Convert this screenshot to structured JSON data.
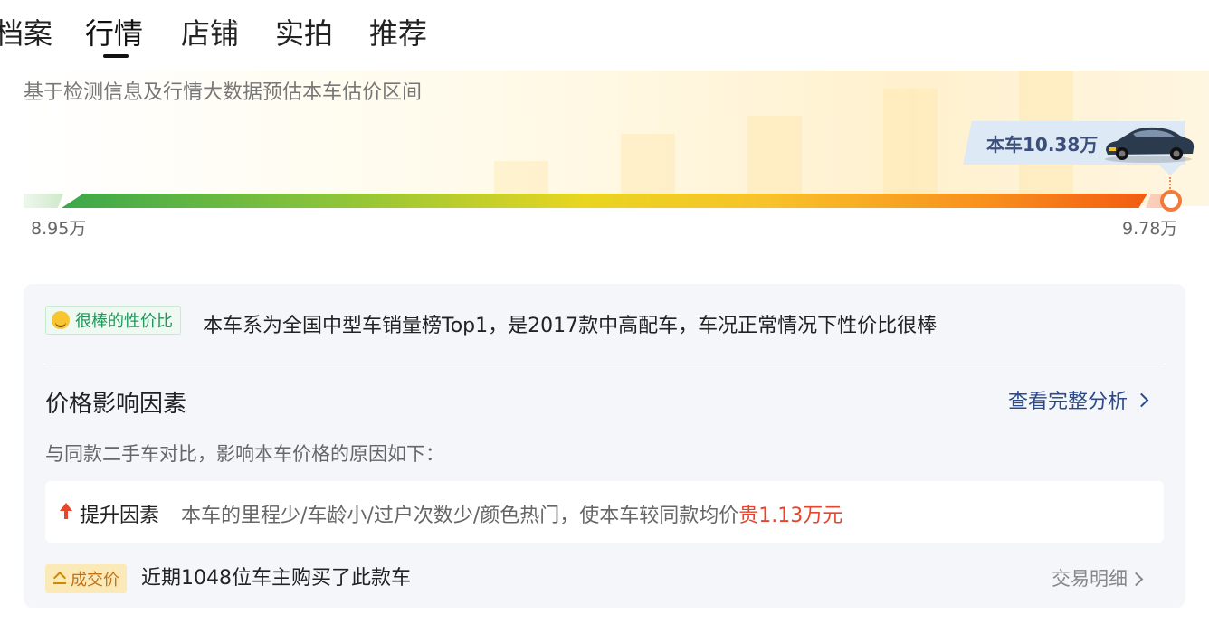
{
  "tabs": [
    {
      "label": "档案",
      "active": false
    },
    {
      "label": "行情",
      "active": true
    },
    {
      "label": "店铺",
      "active": false
    },
    {
      "label": "实拍",
      "active": false
    },
    {
      "label": "推荐",
      "active": false
    }
  ],
  "estimate": {
    "subtitle": "基于检测信息及行情大数据预估本车估价区间",
    "car_price_label": "本车10.38万",
    "car_icon": "car-thumbnail",
    "range_min": "8.95万",
    "range_max": "9.78万",
    "colors": {
      "start": "#3aa84a",
      "middle": "#e8d620",
      "end": "#f25c12",
      "marker": "#f27a3a"
    }
  },
  "analysis": {
    "rating_icon": "star-eyes-emoji-icon",
    "rating_label": "很棒的性价比",
    "summary": "本车系为全国中型车销量榜Top1，是2017款中高配车，车况正常情况下性价比很棒",
    "factors_title": "价格影响因素",
    "full_analysis_link": "查看完整分析",
    "factors_desc": "与同款二手车对比，影响本车价格的原因如下：",
    "factor": {
      "icon": "up-arrow-icon",
      "label": "提升因素",
      "text": "本车的里程少/车龄小/过户次数少/颜色热门，使本车较同款均价",
      "amount": "贵1.13万元",
      "amount_color": "#e8452d"
    },
    "deal": {
      "icon": "tag-icon",
      "label": "成交价",
      "text": "近期1048位车主购买了此款车",
      "detail_link": "交易明细"
    }
  }
}
